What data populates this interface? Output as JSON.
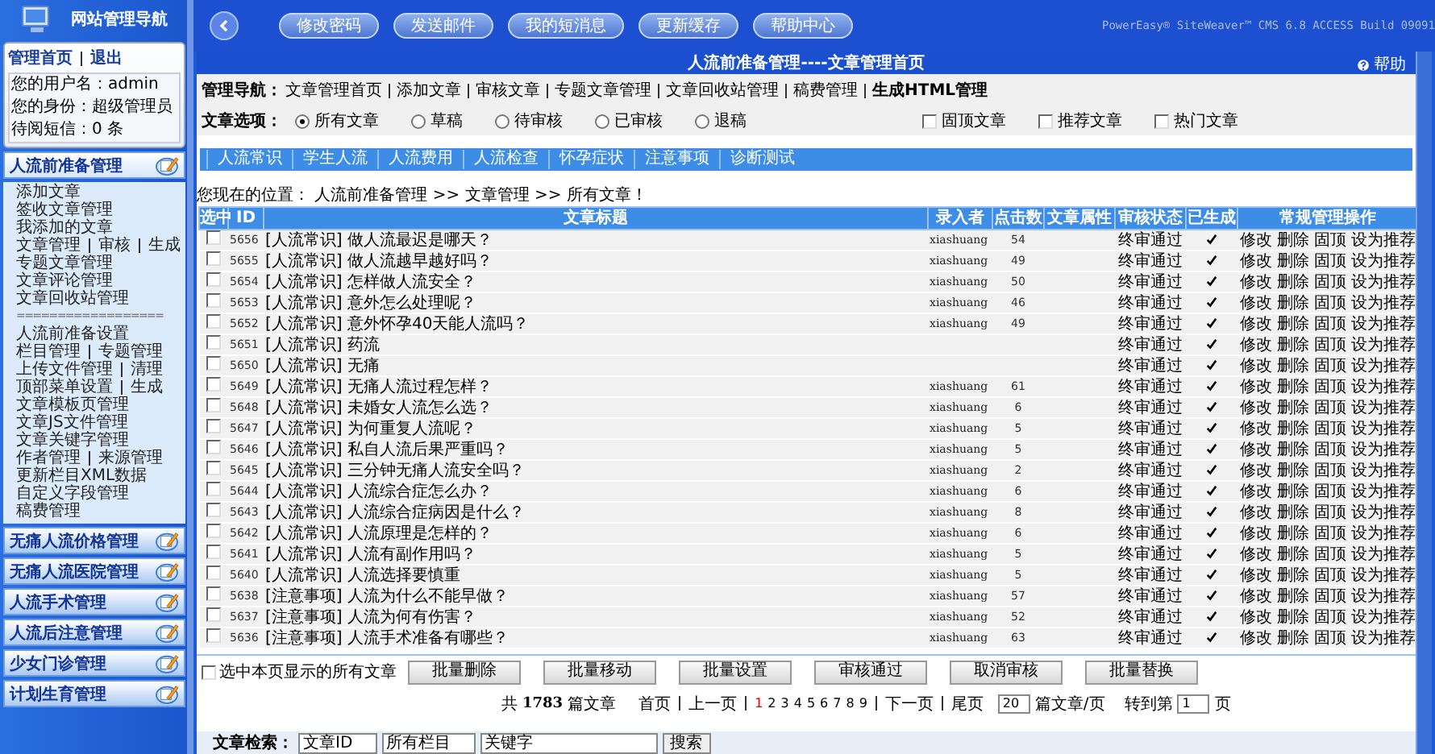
{
  "sidebar": {
    "title": "网站管理导航",
    "links": [
      "管理首页",
      "退出"
    ],
    "user_info": [
      "您的用户名：admin",
      "您的身份：超级管理员",
      "待阅短信：0 条"
    ],
    "sections": [
      {
        "title": "人流前准备管理",
        "expanded": true,
        "items": [
          {
            "kind": "links",
            "links": [
              "添加文章"
            ]
          },
          {
            "kind": "links",
            "links": [
              "签收文章管理"
            ]
          },
          {
            "kind": "links",
            "links": [
              "我添加的文章"
            ]
          },
          {
            "kind": "links",
            "links": [
              "文章管理",
              "审核",
              "生成"
            ]
          },
          {
            "kind": "links",
            "links": [
              "专题文章管理"
            ]
          },
          {
            "kind": "links",
            "links": [
              "文章评论管理"
            ]
          },
          {
            "kind": "links",
            "links": [
              "文章回收站管理"
            ]
          },
          {
            "kind": "separator",
            "text": "=================="
          },
          {
            "kind": "links",
            "links": [
              "人流前准备设置"
            ]
          },
          {
            "kind": "links",
            "links": [
              "栏目管理",
              "专题管理"
            ]
          },
          {
            "kind": "links",
            "links": [
              "上传文件管理",
              "清理"
            ]
          },
          {
            "kind": "links",
            "links": [
              "顶部菜单设置",
              "生成"
            ]
          },
          {
            "kind": "links",
            "links": [
              "文章模板页管理"
            ]
          },
          {
            "kind": "links",
            "links": [
              "文章JS文件管理"
            ]
          },
          {
            "kind": "links",
            "links": [
              "文章关键字管理"
            ]
          },
          {
            "kind": "links",
            "links": [
              "作者管理",
              "来源管理"
            ]
          },
          {
            "kind": "links",
            "links": [
              "更新栏目XML数据"
            ]
          },
          {
            "kind": "links",
            "links": [
              "自定义字段管理"
            ]
          },
          {
            "kind": "links",
            "links": [
              "稿费管理"
            ]
          }
        ]
      },
      {
        "title": "无痛人流价格管理",
        "expanded": false
      },
      {
        "title": "无痛人流医院管理",
        "expanded": false
      },
      {
        "title": "人流手术管理",
        "expanded": false
      },
      {
        "title": "人流后注意管理",
        "expanded": false
      },
      {
        "title": "少女门诊管理",
        "expanded": false
      },
      {
        "title": "计划生育管理",
        "expanded": false
      }
    ]
  },
  "toolbar": {
    "buttons": [
      "修改密码",
      "发送邮件",
      "我的短消息",
      "更新缓存",
      "帮助中心"
    ],
    "version": "PowerEasy® SiteWeaver™ CMS 6.8 ACCESS Build 09091"
  },
  "panel": {
    "title": "人流前准备管理----文章管理首页",
    "help": "帮助",
    "nav_label": "管理导航：",
    "nav_links": [
      {
        "text": "文章管理首页",
        "bold": false
      },
      {
        "text": "添加文章",
        "bold": false
      },
      {
        "text": "审核文章",
        "bold": false
      },
      {
        "text": "专题文章管理",
        "bold": false
      },
      {
        "text": "文章回收站管理",
        "bold": false
      },
      {
        "text": "稿费管理",
        "bold": false
      },
      {
        "text": "生成HTML管理",
        "bold": true
      }
    ],
    "options_label": "文章选项：",
    "radios": [
      {
        "label": "所有文章",
        "selected": true
      },
      {
        "label": "草稿",
        "selected": false
      },
      {
        "label": "待审核",
        "selected": false
      },
      {
        "label": "已审核",
        "selected": false
      },
      {
        "label": "退稿",
        "selected": false
      }
    ],
    "checkboxes": [
      {
        "label": "固顶文章",
        "checked": false
      },
      {
        "label": "推荐文章",
        "checked": false
      },
      {
        "label": "热门文章",
        "checked": false
      }
    ],
    "tabs": [
      {
        "label": "人流常识",
        "selected": false
      },
      {
        "label": "学生人流",
        "selected": false
      },
      {
        "label": "人流费用",
        "selected": false
      },
      {
        "label": "人流检查",
        "selected": false
      },
      {
        "label": "怀孕症状",
        "selected": false
      },
      {
        "label": "注意事项",
        "selected": false
      },
      {
        "label": "诊断测试",
        "selected": false
      }
    ],
    "breadcrumb": "您现在的位置： 人流前准备管理 >> 文章管理 >> 所有文章！",
    "table": {
      "columns": [
        "选中",
        "ID",
        "文章标题",
        "录入者",
        "点击数",
        "文章属性",
        "审核状态",
        "已生成",
        "常规管理操作"
      ],
      "rows": [
        {
          "checked": false,
          "id": "5656",
          "title": "[人流常识] 做人流最迟是哪天？",
          "author": "xiashuang",
          "clicks": "54",
          "status": "终审通过",
          "generated": true,
          "actions": [
            "修改",
            "删除",
            "固顶",
            "设为推荐"
          ]
        },
        {
          "checked": false,
          "id": "5655",
          "title": "[人流常识] 做人流越早越好吗？",
          "author": "xiashuang",
          "clicks": "49",
          "status": "终审通过",
          "generated": true,
          "actions": [
            "修改",
            "删除",
            "固顶",
            "设为推荐"
          ]
        },
        {
          "checked": false,
          "id": "5654",
          "title": "[人流常识] 怎样做人流安全？",
          "author": "xiashuang",
          "clicks": "50",
          "status": "终审通过",
          "generated": true,
          "actions": [
            "修改",
            "删除",
            "固顶",
            "设为推荐"
          ]
        },
        {
          "checked": false,
          "id": "5653",
          "title": "[人流常识] 意外怎么处理呢？",
          "author": "xiashuang",
          "clicks": "46",
          "status": "终审通过",
          "generated": true,
          "actions": [
            "修改",
            "删除",
            "固顶",
            "设为推荐"
          ]
        },
        {
          "checked": false,
          "id": "5652",
          "title": "[人流常识] 意外怀孕40天能人流吗？",
          "author": "xiashuang",
          "clicks": "49",
          "status": "终审通过",
          "generated": true,
          "actions": [
            "修改",
            "删除",
            "固顶",
            "设为推荐"
          ]
        },
        {
          "checked": false,
          "id": "5651",
          "title": "[人流常识] 药流",
          "status": "终审通过",
          "generated": true,
          "actions": [
            "修改",
            "删除",
            "固顶",
            "设为推荐"
          ]
        },
        {
          "checked": false,
          "id": "5650",
          "title": "[人流常识] 无痛",
          "status": "终审通过",
          "generated": true,
          "actions": [
            "修改",
            "删除",
            "固顶",
            "设为推荐"
          ]
        },
        {
          "checked": false,
          "id": "5649",
          "title": "[人流常识] 无痛人流过程怎样？",
          "author": "xiashuang",
          "clicks": "61",
          "status": "终审通过",
          "generated": true,
          "actions": [
            "修改",
            "删除",
            "固顶",
            "设为推荐"
          ]
        },
        {
          "checked": false,
          "id": "5648",
          "title": "[人流常识] 未婚女人流怎么选？",
          "author": "xiashuang",
          "clicks": "6",
          "status": "终审通过",
          "generated": true,
          "actions": [
            "修改",
            "删除",
            "固顶",
            "设为推荐"
          ]
        },
        {
          "checked": false,
          "id": "5647",
          "title": "[人流常识] 为何重复人流呢？",
          "author": "xiashuang",
          "clicks": "5",
          "status": "终审通过",
          "generated": true,
          "actions": [
            "修改",
            "删除",
            "固顶",
            "设为推荐"
          ]
        },
        {
          "checked": false,
          "id": "5646",
          "title": "[人流常识] 私自人流后果严重吗？",
          "author": "xiashuang",
          "clicks": "5",
          "status": "终审通过",
          "generated": true,
          "actions": [
            "修改",
            "删除",
            "固顶",
            "设为推荐"
          ]
        },
        {
          "checked": false,
          "id": "5645",
          "title": "[人流常识] 三分钟无痛人流安全吗？",
          "author": "xiashuang",
          "clicks": "2",
          "status": "终审通过",
          "generated": true,
          "actions": [
            "修改",
            "删除",
            "固顶",
            "设为推荐"
          ]
        },
        {
          "checked": false,
          "id": "5644",
          "title": "[人流常识] 人流综合症怎么办？",
          "author": "xiashuang",
          "clicks": "6",
          "status": "终审通过",
          "generated": true,
          "actions": [
            "修改",
            "删除",
            "固顶",
            "设为推荐"
          ]
        },
        {
          "checked": false,
          "id": "5643",
          "title": "[人流常识] 人流综合症病因是什么？",
          "author": "xiashuang",
          "clicks": "8",
          "status": "终审通过",
          "generated": true,
          "actions": [
            "修改",
            "删除",
            "固顶",
            "设为推荐"
          ]
        },
        {
          "checked": false,
          "id": "5642",
          "title": "[人流常识] 人流原理是怎样的？",
          "author": "xiashuang",
          "clicks": "6",
          "status": "终审通过",
          "generated": true,
          "actions": [
            "修改",
            "删除",
            "固顶",
            "设为推荐"
          ]
        },
        {
          "checked": false,
          "id": "5641",
          "title": "[人流常识] 人流有副作用吗？",
          "author": "xiashuang",
          "clicks": "5",
          "status": "终审通过",
          "generated": true,
          "actions": [
            "修改",
            "删除",
            "固顶",
            "设为推荐"
          ]
        },
        {
          "checked": false,
          "id": "5640",
          "title": "[人流常识] 人流选择要慎重",
          "author": "xiashuang",
          "clicks": "5",
          "status": "终审通过",
          "generated": true,
          "actions": [
            "修改",
            "删除",
            "固顶",
            "设为推荐"
          ]
        },
        {
          "checked": false,
          "id": "5638",
          "title": "[注意事项] 人流为什么不能早做？",
          "author": "xiashuang",
          "clicks": "57",
          "status": "终审通过",
          "generated": true,
          "actions": [
            "修改",
            "删除",
            "固顶",
            "设为推荐"
          ]
        },
        {
          "checked": false,
          "id": "5637",
          "title": "[注意事项] 人流为何有伤害？",
          "author": "xiashuang",
          "clicks": "52",
          "status": "终审通过",
          "generated": true,
          "actions": [
            "修改",
            "删除",
            "固顶",
            "设为推荐"
          ]
        },
        {
          "checked": false,
          "id": "5636",
          "title": "[注意事项] 人流手术准备有哪些？",
          "author": "xiashuang",
          "clicks": "63",
          "status": "终审通过",
          "generated": true,
          "actions": [
            "修改",
            "删除",
            "固顶",
            "设为推荐"
          ]
        }
      ]
    },
    "select_all": {
      "label": "选中本页显示的所有文章",
      "checked": false
    },
    "batch_buttons": [
      "批量删除",
      "批量移动",
      "批量设置",
      "审核通过",
      "取消审核",
      "批量替换"
    ],
    "pagination": {
      "total_prefix": "共",
      "total": "1783",
      "total_suffix": "篇文章",
      "first": "首页",
      "prev": "上一页",
      "pages": [
        {
          "label": "1",
          "selected": true
        },
        {
          "label": "2",
          "selected": false
        },
        {
          "label": "3",
          "selected": false
        },
        {
          "label": "4",
          "selected": false
        },
        {
          "label": "5",
          "selected": false
        },
        {
          "label": "6",
          "selected": false
        },
        {
          "label": "7",
          "selected": false
        },
        {
          "label": "8",
          "selected": false
        },
        {
          "label": "9",
          "selected": false
        }
      ],
      "next": "下一页",
      "last": "尾页",
      "per_page": "20",
      "per_page_suffix": "篇文章/页",
      "goto_prefix": "转到第",
      "goto_value": "1",
      "goto_suffix": "页"
    },
    "search": {
      "label": "文章检索：",
      "field_select": "文章ID",
      "category_select": "所有栏目",
      "keyword": "关键字",
      "button": "搜索"
    }
  }
}
